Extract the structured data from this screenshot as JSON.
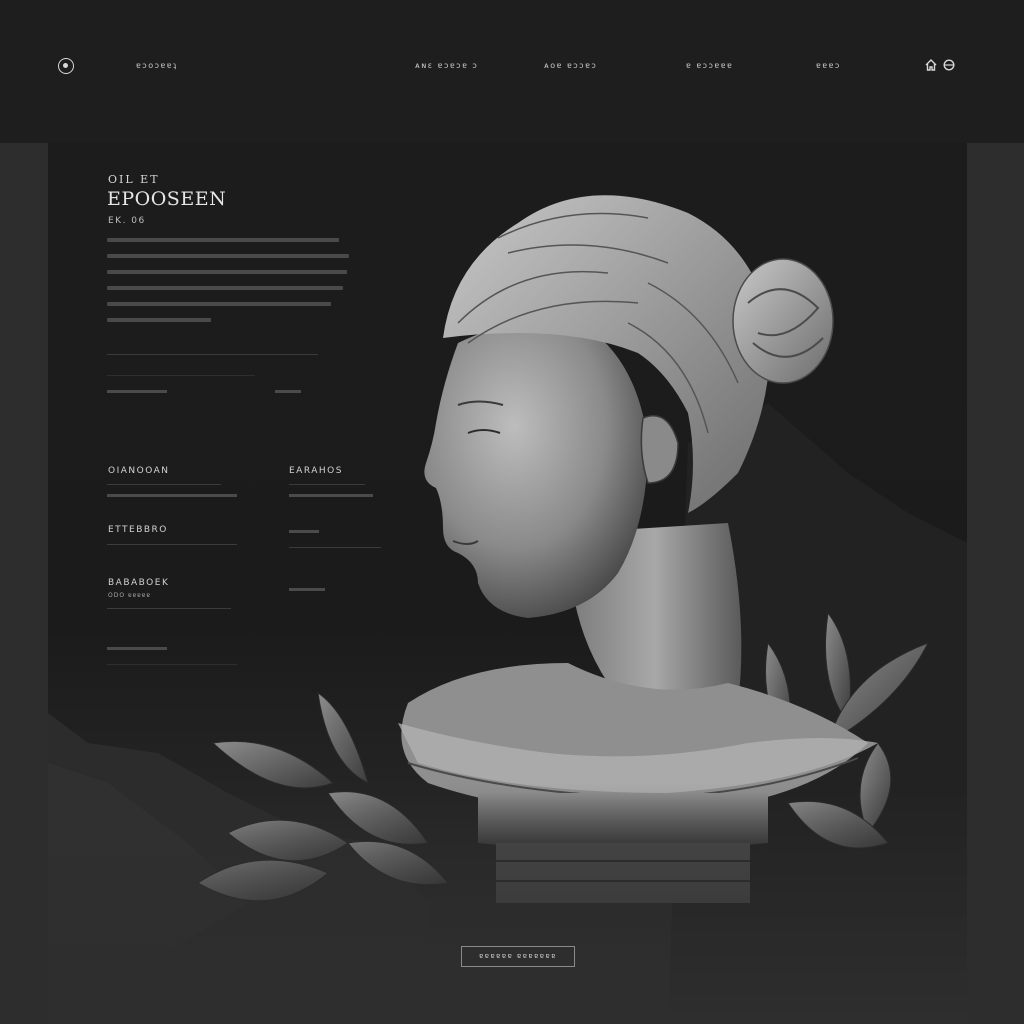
{
  "header": {
    "brand": "ɐɔoɔɐɐʇ",
    "nav": [
      "ᴀɴɛ ɐɔɐɔɐ ɔ",
      "ᴀᴏɐ ɐɔɔɐɔ",
      "ɐ ɐɔɔɐɐɐ",
      "ɐɐɐɔ"
    ]
  },
  "hero": {
    "eyebrow": "OIL ET",
    "headline": "EPOOSEEN",
    "subline": "EK. 06"
  },
  "fields": {
    "field1_title": "OIANOOAN",
    "field2_title": "EARAHOS",
    "field3_title": "ETTEBBRO",
    "field4_title": "BABABOEK",
    "field4_sub": "ODO ɐɐɐɐɐ"
  },
  "cta": {
    "label": "ɐɐɐɐɐɐ ɐɐɐɐɐɐɐ"
  },
  "colors": {
    "background": "#1c1c1c",
    "panel": "#2d2d2d",
    "text": "#d6d6d6"
  },
  "icons": [
    "logo-icon",
    "home-icon",
    "globe-icon"
  ]
}
